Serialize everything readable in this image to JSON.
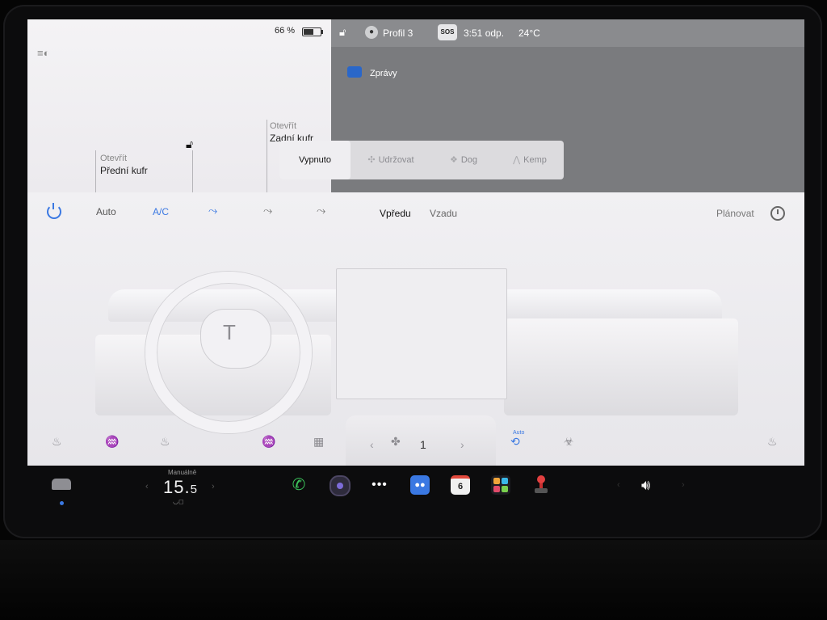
{
  "status": {
    "battery": "66 %",
    "profile": "Profil 3",
    "sos": "SOS",
    "time": "3:51 odp.",
    "temperature": "24°C"
  },
  "car": {
    "front_trunk_state": "Otevřít",
    "front_trunk_label": "Přední kufr",
    "rear_trunk_state": "Otevřít",
    "rear_trunk_label": "Zadní kufr"
  },
  "messages_label": "Zprávy",
  "modes": {
    "off": "Vypnuto",
    "keep": "Udržovat",
    "dog": "Dog",
    "camp": "Kemp"
  },
  "climate": {
    "auto": "Auto",
    "ac": "A/C",
    "front": "Vpředu",
    "rear": "Vzadu",
    "schedule": "Plánovat",
    "fan_speed": "1",
    "recirc_auto": "Auto"
  },
  "dock": {
    "manual_label": "Manuálně",
    "temp_int": "15.",
    "temp_dec": "5",
    "calendar_day": "6"
  },
  "icons": {
    "power": "power-icon",
    "clock": "clock-icon",
    "accent_color": "#3a78e2"
  }
}
